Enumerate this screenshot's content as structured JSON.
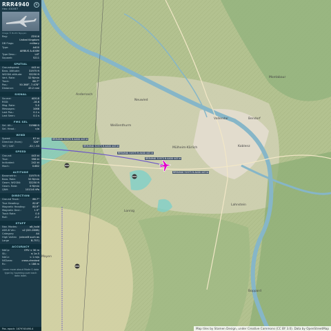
{
  "aircraft": {
    "callsign": "RRR4940",
    "subtitle": "Hex: 43C6E7",
    "photo_credit": "Image © Bodhi Nguyen"
  },
  "ident_rows": [
    {
      "k": "Reg:",
      "v": "ZZ416"
    },
    {
      "k": "",
      "v": "United Kingdom"
    },
    {
      "k": "DB Flags:",
      "v": "military"
    },
    {
      "k": "Type:",
      "v": "A400"
    },
    {
      "k": "",
      "v": "AIRBUS A-400M"
    },
    {
      "k": "Type Desc.:",
      "v": "L4T"
    },
    {
      "k": "Squawk:",
      "v": "5211"
    }
  ],
  "sections": [
    {
      "title": "SPATIAL",
      "rows": [
        {
          "k": "Groundspeed:",
          "v": "443 kt"
        },
        {
          "k": "Baro. Altitude:",
          "v": "31975 ft"
        },
        {
          "k": "WGS84 altitude:",
          "v": "32250 ft"
        },
        {
          "k": "Vert. Rate:",
          "v": "32 ft/min"
        },
        {
          "k": "Track:",
          "v": "86.7°"
        },
        {
          "k": "Pos.:",
          "v": "50.368°, 7.478°"
        },
        {
          "k": "Distance:",
          "v": "45.2 nmi"
        }
      ]
    },
    {
      "title": "SIGNAL",
      "rows": [
        {
          "k": "Source:",
          "v": "ADS-B"
        },
        {
          "k": "RSSI:",
          "v": "-16.6"
        },
        {
          "k": "Msg. Rate:",
          "v": "5.0"
        },
        {
          "k": "Messages:",
          "v": "1066"
        },
        {
          "k": "Last Pos.:",
          "v": "0.1 s"
        },
        {
          "k": "Last Seen:",
          "v": "0.1 s"
        }
      ]
    },
    {
      "title": "FMS SEL",
      "rows": [
        {
          "k": "Sel. Alt.:",
          "v": "31968 ft"
        },
        {
          "k": "Sel. Head.:",
          "v": "n/a"
        }
      ]
    },
    {
      "title": "WIND",
      "rows": [
        {
          "k": "Speed:",
          "v": "67 kt"
        },
        {
          "k": "Direction (from):",
          "v": "326°"
        },
        {
          "k": "TAT / OAT:",
          "v": "-32 / -53"
        }
      ]
    },
    {
      "title": "SPEED",
      "rows": [
        {
          "k": "Ground:",
          "v": "443 kt"
        },
        {
          "k": "True:",
          "v": "398 kt"
        },
        {
          "k": "Indicated:",
          "v": "242 kt"
        },
        {
          "k": "Mach:",
          "v": "0.682"
        }
      ]
    },
    {
      "title": "ALTITUDE",
      "rows": [
        {
          "k": "Barometric:",
          "v": "31975 ft"
        },
        {
          "k": "Baro. Rate:",
          "v": "32 ft/min"
        },
        {
          "k": "Geom. WGS84:",
          "v": "32250 ft"
        },
        {
          "k": "Geom. Rate:",
          "v": "0 ft/min"
        },
        {
          "k": "QNH:",
          "v": "1013.6 hPa"
        }
      ]
    },
    {
      "title": "DIRECTION",
      "rows": [
        {
          "k": "Ground Track:",
          "v": "86.7°"
        },
        {
          "k": "True Heading:",
          "v": "82.8°"
        },
        {
          "k": "Magnetic Heading:",
          "v": "80.9°"
        },
        {
          "k": "Magnetic Decl.:",
          "v": "1.9°"
        },
        {
          "k": "Track Rate:",
          "v": "0.0"
        },
        {
          "k": "Roll:",
          "v": "-0.2"
        }
      ]
    },
    {
      "title": "STUFF",
      "rows": [
        {
          "k": "Nav. Modes:",
          "v": "alt_hold"
        },
        {
          "k": "ADS-B Ver.:",
          "v": "v2 (DO-260B)"
        },
        {
          "k": "Category:",
          "v": "A4"
        },
        {
          "k": "High Vortex Large",
          "v": "(aircraft such as B-757)"
        }
      ]
    },
    {
      "title": "ACCURACY",
      "rows": [
        {
          "k": "NACp:",
          "v": "EPU < 30 m"
        },
        {
          "k": "SIL:",
          "v": "≤ 1e-5"
        },
        {
          "k": "NACv:",
          "v": "< 1 m/s"
        },
        {
          "k": "NICbaro:",
          "v": "cross-checked"
        },
        {
          "k": "Rc:",
          "v": "< 186 m"
        }
      ]
    }
  ],
  "note": "Learn more about Mode S data type by hovering over each data label.",
  "footer": "Pos. epoch: 1679745490.4",
  "attribution": "Map tiles by Stamen Design, under Creative Commons (CC BY 3.0). Data by OpenStreetMap",
  "towns": [
    {
      "name": "Neuwied"
    },
    {
      "name": "Koblenz"
    },
    {
      "name": "Mülheim-Kärlich"
    },
    {
      "name": "Weißenthurm"
    },
    {
      "name": "Andernach"
    },
    {
      "name": "Mayen"
    },
    {
      "name": "Lonnig"
    },
    {
      "name": "Vallendar"
    },
    {
      "name": "Bendorf"
    },
    {
      "name": "Lahnstein"
    },
    {
      "name": "Boppard"
    },
    {
      "name": "Montabaur"
    }
  ],
  "route_labels": [
    {
      "text": "RRR4940 31975 ft A400 443 kt"
    },
    {
      "text": "RRR4940 31975 ft A400 443 kt"
    },
    {
      "text": "RRR4940 31975 ft A400 443 kt"
    },
    {
      "text": "RRR4940 31975 ft A400 443 kt"
    },
    {
      "text": "RRR4940 31975 ft A400 443 kt"
    }
  ],
  "colors": {
    "panel_bg": "#1c3a48",
    "aircraft": "#e000c8",
    "river": "#86b6c8",
    "track": "#6a55c8"
  }
}
